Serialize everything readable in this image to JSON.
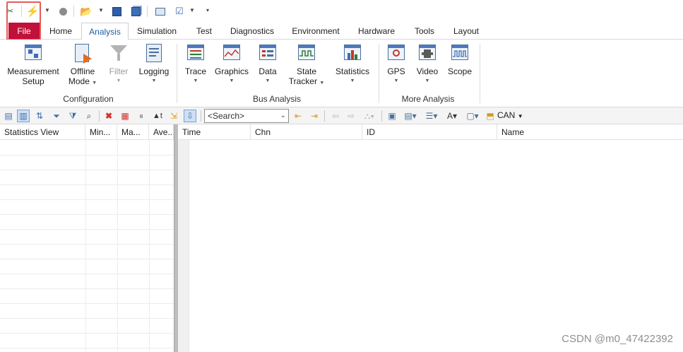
{
  "quick_access": {
    "icons": [
      "tools-icon",
      "lightning-start-icon",
      "stop-circle-icon",
      "open-folder-icon",
      "save-icon",
      "save-as-icon",
      "config-icon",
      "check-icon",
      "customize-icon"
    ]
  },
  "tabs": [
    {
      "id": "file",
      "label": "File"
    },
    {
      "id": "home",
      "label": "Home"
    },
    {
      "id": "analysis",
      "label": "Analysis",
      "active": true
    },
    {
      "id": "simulation",
      "label": "Simulation"
    },
    {
      "id": "test",
      "label": "Test"
    },
    {
      "id": "diagnostics",
      "label": "Diagnostics"
    },
    {
      "id": "environment",
      "label": "Environment"
    },
    {
      "id": "hardware",
      "label": "Hardware"
    },
    {
      "id": "tools",
      "label": "Tools"
    },
    {
      "id": "layout",
      "label": "Layout"
    }
  ],
  "ribbon": {
    "configuration": {
      "label": "Configuration",
      "measurement_setup": [
        "Measurement",
        "Setup"
      ],
      "offline_mode": [
        "Offline",
        "Mode"
      ],
      "filter": "Filter",
      "logging": "Logging"
    },
    "bus_analysis": {
      "label": "Bus Analysis",
      "trace": "Trace",
      "graphics": "Graphics",
      "data": "Data",
      "state_tracker": [
        "State",
        "Tracker"
      ],
      "statistics": "Statistics"
    },
    "more_analysis": {
      "label": "More Analysis",
      "gps": "GPS",
      "video": "Video",
      "scope": "Scope"
    }
  },
  "toolbar": {
    "search_placeholder": "<Search>",
    "channel": "CAN"
  },
  "statistics_view": {
    "columns": [
      "Statistics View",
      "Min...",
      "Ma...",
      "Ave..."
    ]
  },
  "trace_view": {
    "columns": [
      "Time",
      "Chn",
      "ID",
      "Name"
    ]
  },
  "watermark": "CSDN @m0_47422392",
  "colors": {
    "file_tab": "#c1113a",
    "active_tab_text": "#1b5fa8",
    "highlight": "#e65a5a"
  }
}
